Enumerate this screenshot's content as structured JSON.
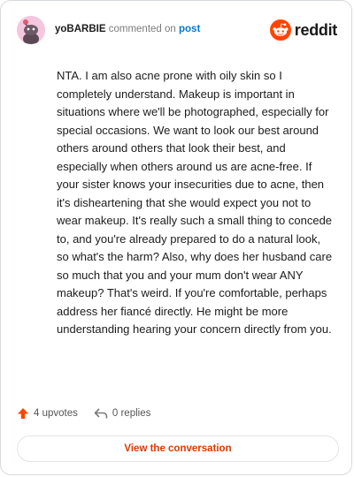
{
  "comment": {
    "username": "yoBARBIE",
    "commented_on": "commented on",
    "post_link": "post",
    "body": "NTA. I am also acne prone with oily skin so I completely understand. Makeup is important in situations where we'll be photographed, especially for special occasions. We want to look our best around others around others that look their best, and especially when others around us are acne-free. If your sister knows your insecurities due to acne, then it's disheartening that she would expect you not to wear makeup. It's really such a small thing to concede to, and you're already prepared to do a natural look, so what's the harm? Also, why does her husband care so much that you and your mum don't wear ANY makeup? That's weird. If you're comfortable, perhaps address her fiancé directly. He might be more understanding hearing your concern directly from you."
  },
  "brand": {
    "word": "reddit",
    "icon": "reddit-snoo-icon",
    "color": "#ff4500"
  },
  "actions": {
    "upvotes": "4 upvotes",
    "upvote_icon": "upvote-arrow-icon",
    "replies": "0 replies",
    "reply_icon": "reply-arrow-icon"
  },
  "cta": {
    "label": "View the conversation"
  },
  "colors": {
    "accent": "#ff4500",
    "link": "#0079d3",
    "cta_text": "#d93a00"
  }
}
